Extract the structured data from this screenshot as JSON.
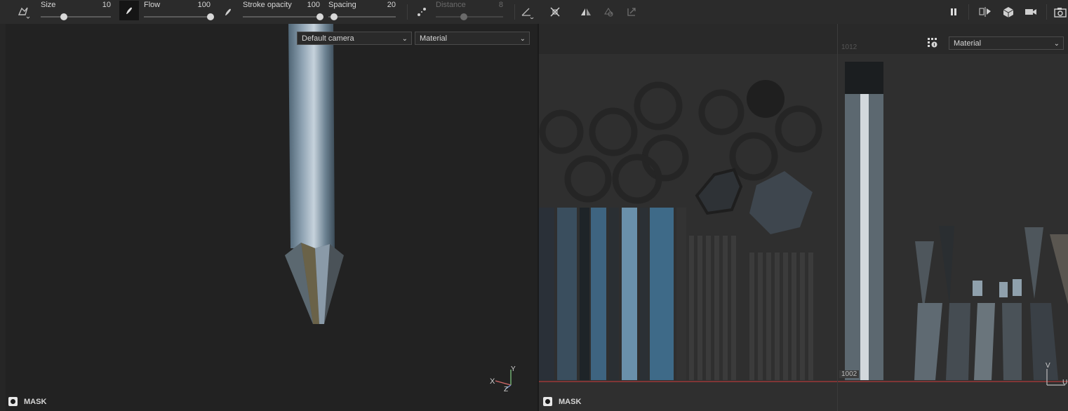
{
  "toolbar": {
    "size": {
      "label": "Size",
      "value": "10",
      "level": 0.3
    },
    "flow": {
      "label": "Flow",
      "value": "100",
      "level": 1.0
    },
    "stroke_opacity": {
      "label": "Stroke opacity",
      "value": "100",
      "level": 1.0
    },
    "spacing": {
      "label": "Spacing",
      "value": "20",
      "level": 0.05
    },
    "distance": {
      "label": "Distance",
      "value": "8",
      "level": 0.4,
      "disabled": true
    },
    "icons": [
      "brush-preset-icon",
      "brush-alpha-icon",
      "flow-brush-icon",
      "lazy-mouse-icon",
      "line-angle-icon",
      "symmetry-icon",
      "mirror-icon",
      "mirror-axis-icon",
      "transform-icon",
      "pause-icon",
      "split-view-icon",
      "cube-view-icon",
      "camera-icon",
      "screenshot-icon"
    ]
  },
  "viewport3d": {
    "camera_select": "Default camera",
    "material_select": "Material",
    "mask_label": "MASK",
    "axis_labels": {
      "x": "X",
      "y": "Y",
      "z": "Z"
    }
  },
  "viewport2d": {
    "material_select": "Material",
    "mask_label": "MASK",
    "udim_top": "1012",
    "udim_bottom": "1002",
    "axis_labels": {
      "v": "V",
      "u": "U"
    }
  }
}
